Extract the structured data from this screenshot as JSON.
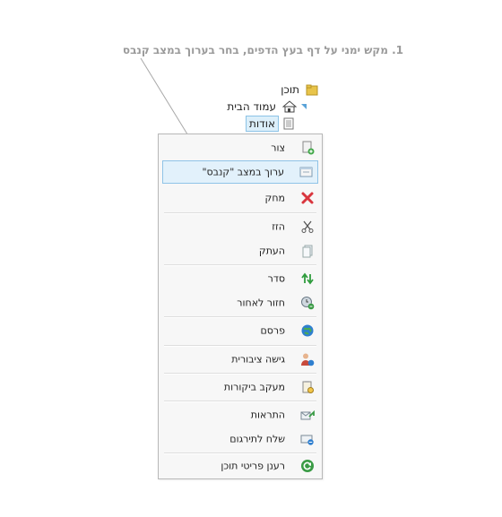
{
  "instruction": "1. מקש ימני על דף בעץ הדפים, בחר בערוך במצב קנבס",
  "tree": {
    "root_label": "תוכן",
    "home_label": "עמוד הבית",
    "about_label": "אודות"
  },
  "menu": {
    "items": [
      {
        "label": "צור",
        "icon": "create-page-icon"
      },
      {
        "label": "ערוך במצב \"קנבס\"",
        "icon": "canvas-edit-icon"
      },
      {
        "label": "מחק",
        "icon": "delete-icon"
      },
      {
        "label": "הזז",
        "icon": "cut-icon"
      },
      {
        "label": "העתק",
        "icon": "copy-icon"
      },
      {
        "label": "סדר",
        "icon": "sort-icon"
      },
      {
        "label": "חזור לאחור",
        "icon": "rollback-icon"
      },
      {
        "label": "פרסם",
        "icon": "publish-icon"
      },
      {
        "label": "גישה ציבורית",
        "icon": "public-access-icon"
      },
      {
        "label": "מעקב ביקורות",
        "icon": "audit-trail-icon"
      },
      {
        "label": "התראות",
        "icon": "notifications-icon"
      },
      {
        "label": "שלח לתירגום",
        "icon": "send-translation-icon"
      },
      {
        "label": "רענן פריטי תוכן",
        "icon": "refresh-icon"
      }
    ]
  },
  "colors": {
    "instruction_text": "#9a9a9a",
    "active_item_bg": "#e2f1fb",
    "active_item_border": "#8fc3e7",
    "delete_red": "#d9363e"
  }
}
